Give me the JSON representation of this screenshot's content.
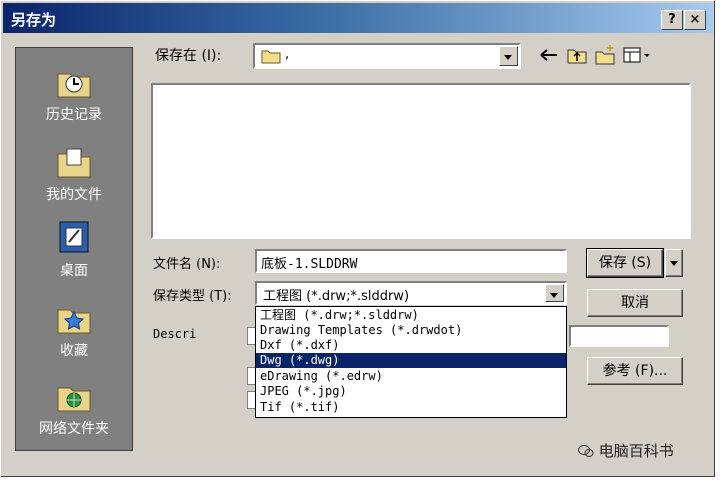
{
  "window": {
    "title": "另存为",
    "help_label": "?",
    "close_label": "×"
  },
  "places": [
    {
      "label": "历史记录",
      "icon": "history-folder-icon"
    },
    {
      "label": "我的文件",
      "icon": "my-documents-icon"
    },
    {
      "label": "桌面",
      "icon": "desktop-icon"
    },
    {
      "label": "收藏",
      "icon": "favorites-icon"
    },
    {
      "label": "网络文件夹",
      "icon": "network-folder-icon"
    }
  ],
  "save_in": {
    "label": "保存在 (I):",
    "value": ","
  },
  "toolbar": [
    "back-arrow-icon",
    "up-folder-icon",
    "new-folder-icon",
    "view-menu-icon"
  ],
  "file_name": {
    "label": "文件名 (N):",
    "value": "底板-1.SLDDRW"
  },
  "file_type": {
    "label": "保存类型 (T):",
    "value": "工程图 (*.drw;*.slddrw)",
    "options": [
      {
        "label": "工程图 (*.drw;*.slddrw)",
        "selected": false
      },
      {
        "label": "Drawing Templates (*.drwdot)",
        "selected": false
      },
      {
        "label": "Dxf (*.dxf)",
        "selected": false
      },
      {
        "label": "Dwg (*.dwg)",
        "selected": true
      },
      {
        "label": "eDrawing (*.edrw)",
        "selected": false
      },
      {
        "label": "JPEG (*.jpg)",
        "selected": false
      },
      {
        "label": "Tif (*.tif)",
        "selected": false
      }
    ]
  },
  "description": {
    "label": "Descri"
  },
  "buttons": {
    "save": "保存 (S)",
    "cancel": "取消",
    "reference": "参考 (F)..."
  },
  "watermark": "电脑百科书",
  "colors": {
    "title_start": "#0a246a",
    "title_end": "#a6caf0",
    "selection": "#0a246a",
    "face": "#d4d0c8"
  }
}
